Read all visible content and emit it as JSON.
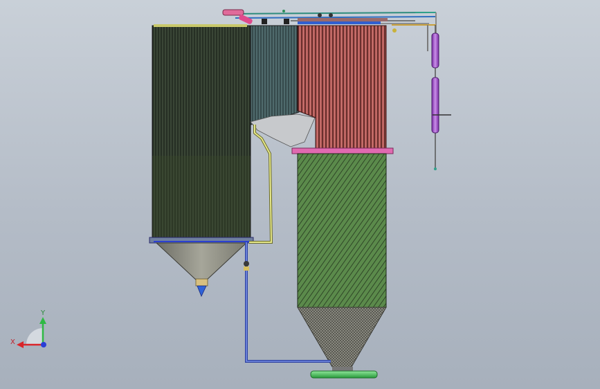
{
  "viewport": {
    "background_top": "#c9d0d8",
    "background_bottom": "#a7b0bc"
  },
  "triad": {
    "x_label": "X",
    "y_label": "Y",
    "x_color": "#d9252a",
    "y_color": "#2fb944",
    "z_color": "#2a3fd6"
  },
  "model": {
    "colors": {
      "left_tube_bank": "#2f3a2c",
      "duct_bank": "#3d5558",
      "right_tube_bank": "#a04a49",
      "packed_column": "#3f6b39",
      "hopper": "#8a8a7a",
      "outlet_pipe": "#cfd36a",
      "drain_pipe": "#4a63c6",
      "flange": "#e04a8c",
      "instrument": "#9a45c8",
      "base_skid": "#3cb84e"
    }
  }
}
